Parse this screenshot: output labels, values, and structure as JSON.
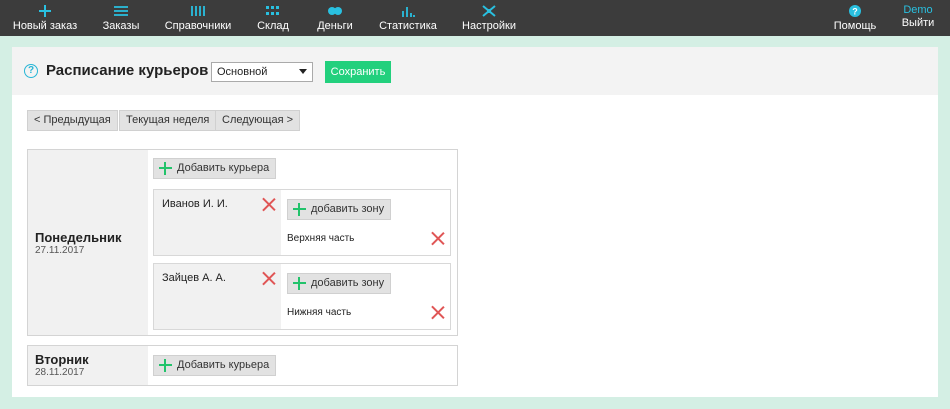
{
  "nav": {
    "items": [
      {
        "label": "Новый заказ",
        "icon": "plus-icon"
      },
      {
        "label": "Заказы",
        "icon": "list-icon"
      },
      {
        "label": "Справочники",
        "icon": "books-icon"
      },
      {
        "label": "Склад",
        "icon": "grid-icon"
      },
      {
        "label": "Деньги",
        "icon": "coins-icon"
      },
      {
        "label": "Статистика",
        "icon": "bar-chart-icon"
      },
      {
        "label": "Настройки",
        "icon": "wrench-icon"
      }
    ],
    "help": {
      "label": "Помощь",
      "icon": "help-icon"
    },
    "user": {
      "name": "Demo",
      "logout_label": "Выйти"
    },
    "accent": "#29c0e0"
  },
  "header": {
    "title": "Расписание курьеров",
    "schedule_select": "Основной",
    "save_label": "Сохранить",
    "save_color": "#22d07d"
  },
  "week_nav": {
    "prev": "< Предыдущая",
    "current": "Текущая неделя",
    "next": "Следующая >"
  },
  "days": [
    {
      "name": "Понедельник",
      "date": "27.11.2017",
      "add_courier_label": "Добавить курьера",
      "couriers": [
        {
          "name": "Иванов И. И.",
          "add_zone_label": "добавить зону",
          "zone": "Верхняя часть"
        },
        {
          "name": "Зайцев А. А.",
          "add_zone_label": "добавить зону",
          "zone": "Нижняя часть"
        }
      ]
    },
    {
      "name": "Вторник",
      "date": "28.11.2017",
      "add_courier_label": "Добавить курьера",
      "couriers": []
    }
  ]
}
